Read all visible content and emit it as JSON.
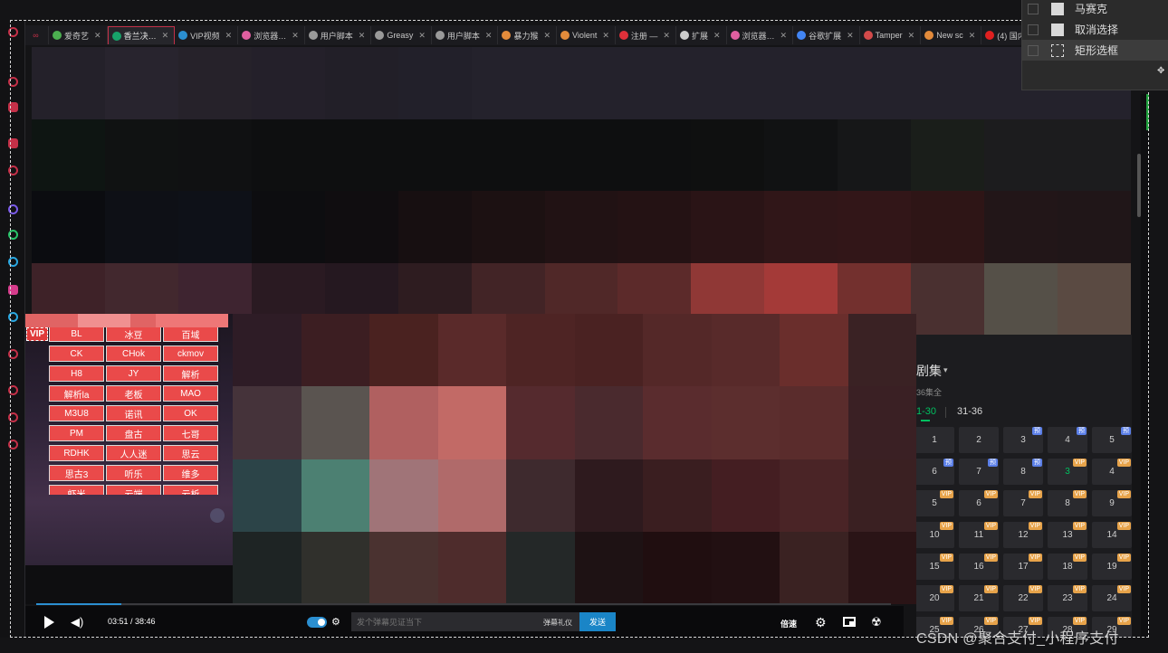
{
  "tabs": [
    {
      "label": "",
      "fav": "#c43048",
      "kind": "mute",
      "name": "tab-mute"
    },
    {
      "label": "爱奇艺",
      "fav": "#4caf50",
      "active": false,
      "name": "tab-iqiyi"
    },
    {
      "label": "香兰决…",
      "fav": "#17a36a",
      "active": true,
      "name": "tab-current"
    },
    {
      "label": "VIP视频",
      "fav": "#2b8fd1",
      "active": false,
      "name": "tab-vip"
    },
    {
      "label": "浏览器…",
      "fav": "#e05fa0",
      "active": false,
      "name": "tab-browser-1"
    },
    {
      "label": "用户脚本",
      "fav": "#9a9a9a",
      "active": false,
      "name": "tab-userscript-1"
    },
    {
      "label": "Greasy",
      "fav": "#9a9a9a",
      "active": false,
      "name": "tab-greasy"
    },
    {
      "label": "用户脚本",
      "fav": "#9a9a9a",
      "active": false,
      "name": "tab-userscript-2"
    },
    {
      "label": "暴力猴",
      "fav": "#e38b3b",
      "active": false,
      "name": "tab-violentmonkey-cn"
    },
    {
      "label": "Violent",
      "fav": "#e38b3b",
      "active": false,
      "name": "tab-violent"
    },
    {
      "label": "注册 —",
      "fav": "#e0303a",
      "active": false,
      "name": "tab-register"
    },
    {
      "label": "扩展",
      "fav": "#cccccc",
      "active": false,
      "name": "tab-extensions"
    },
    {
      "label": "浏览器…",
      "fav": "#e05fa0",
      "active": false,
      "name": "tab-browser-2"
    },
    {
      "label": "谷歌扩展",
      "fav": "#4285f4",
      "active": false,
      "name": "tab-google-ext"
    },
    {
      "label": "Tamper",
      "fav": "#d34a4a",
      "active": false,
      "name": "tab-tamper"
    },
    {
      "label": "New sc",
      "fav": "#e38b3b",
      "active": false,
      "name": "tab-new-script"
    },
    {
      "label": "(4) 国内…",
      "fav": "#e02020",
      "active": false,
      "name": "tab-youtube"
    }
  ],
  "context_menu": {
    "items": [
      {
        "label": "马赛克",
        "icon": "doc-icon"
      },
      {
        "label": "取消选择",
        "icon": "doc-icon"
      },
      {
        "label": "矩形选框",
        "icon": "rect-select-icon",
        "hover": true
      }
    ]
  },
  "vip": {
    "label": "VIP",
    "buttons": [
      "BL",
      "冰豆",
      "百域",
      "CK",
      "CHok",
      "ckmov",
      "H8",
      "JY",
      "解析",
      "解析la",
      "老板",
      "MAO",
      "M3U8",
      "诺讯",
      "OK",
      "PM",
      "盘古",
      "七哥",
      "RDHK",
      "人人迷",
      "思云",
      "思古3",
      "听乐",
      "维多",
      "虾米",
      "云端",
      "云析"
    ]
  },
  "episodes": {
    "title": "剧集",
    "subtitle": "36集全",
    "ranges": [
      "1-30",
      "31-36"
    ],
    "active_range": "1-30",
    "current": "3",
    "rows": [
      [
        {
          "n": "1",
          "b": ""
        },
        {
          "n": "2",
          "b": ""
        },
        {
          "n": "3",
          "b": "预"
        },
        {
          "n": "4",
          "b": "预"
        },
        {
          "n": "5",
          "b": "预"
        }
      ],
      [
        {
          "n": "6",
          "b": "预"
        },
        {
          "n": "7",
          "b": "预"
        },
        {
          "n": "8",
          "b": "预"
        },
        {
          "n": "3",
          "b": "VIP",
          "cur": true
        },
        {
          "n": "4",
          "b": "VIP"
        }
      ],
      [
        {
          "n": "5",
          "b": "VIP"
        },
        {
          "n": "6",
          "b": "VIP"
        },
        {
          "n": "7",
          "b": "VIP"
        },
        {
          "n": "8",
          "b": "VIP"
        },
        {
          "n": "9",
          "b": "VIP"
        }
      ],
      [
        {
          "n": "10",
          "b": "VIP"
        },
        {
          "n": "11",
          "b": "VIP"
        },
        {
          "n": "12",
          "b": "VIP"
        },
        {
          "n": "13",
          "b": "VIP"
        },
        {
          "n": "14",
          "b": "VIP"
        }
      ],
      [
        {
          "n": "15",
          "b": "VIP"
        },
        {
          "n": "16",
          "b": "VIP"
        },
        {
          "n": "17",
          "b": "VIP"
        },
        {
          "n": "18",
          "b": "VIP"
        },
        {
          "n": "19",
          "b": "VIP"
        }
      ],
      [
        {
          "n": "20",
          "b": "VIP"
        },
        {
          "n": "21",
          "b": "VIP"
        },
        {
          "n": "22",
          "b": "VIP"
        },
        {
          "n": "23",
          "b": "VIP"
        },
        {
          "n": "24",
          "b": "VIP"
        }
      ],
      [
        {
          "n": "25",
          "b": "VIP"
        },
        {
          "n": "26",
          "b": "VIP"
        },
        {
          "n": "27",
          "b": "VIP"
        },
        {
          "n": "28",
          "b": "VIP"
        },
        {
          "n": "29",
          "b": "VIP"
        }
      ]
    ]
  },
  "player": {
    "time": "03:51 / 38:46",
    "progress": 0.0993,
    "danmaku_placeholder": "发个弹幕见证当下",
    "danmaku_gift": "弹幕礼仪",
    "send_label": "发送",
    "speed_label": "倍速"
  },
  "watermark": "CSDN @聚合支付_小程序支付",
  "colors": {
    "accent_red": "#ea4a4a",
    "accent_blue": "#1a85c7",
    "accent_green": "#00c060",
    "vip_badge": "#e7a34a"
  },
  "mosaic_colors": [
    [
      "#24212a",
      "#28242e",
      "#26222a",
      "#24202a",
      "#221f28",
      "#22202a",
      "#24222c",
      "#24222c",
      "#24222c",
      "#24222c",
      "#24222c",
      "#24222c",
      "#24222c",
      "#24222c",
      "#24222c"
    ],
    [
      "#0e1512",
      "#101212",
      "#101112",
      "#0e0f10",
      "#0e0f10",
      "#0e0f10",
      "#0e0f10",
      "#0e0f10",
      "#0e0f10",
      "#0f1010",
      "#111213",
      "#161718",
      "#1a1e1a",
      "#1c1c1e",
      "#1c1c1e"
    ],
    [
      "#0b0c10",
      "#0e1016",
      "#0e1118",
      "#0d0d10",
      "#100d10",
      "#170f11",
      "#1c1112",
      "#211214",
      "#241214",
      "#2a1416",
      "#301618",
      "#321618",
      "#2e1516",
      "#221618",
      "#201618"
    ],
    [
      "#3e2228",
      "#42282e",
      "#3e2430",
      "#2a1a22",
      "#251820",
      "#2e1c20",
      "#422426",
      "#502828",
      "#5c2a2a",
      "#903836",
      "#a43a38",
      "#73302e",
      "#4a3030",
      "#555048",
      "#5a4a42"
    ]
  ],
  "mosaic_lower_colors": [
    [
      "#2e1c26",
      "#3c1e22",
      "#4a2220",
      "#5a2a2a",
      "#4e2424",
      "#4a2222",
      "#542828",
      "#582a2a",
      "#6a2e2c",
      "#3a2224"
    ],
    [
      "#45333a",
      "#5a5450",
      "#b06060",
      "#c26a66",
      "#552a2e",
      "#4a2a2e",
      "#5a2c2e",
      "#5c2e2e",
      "#5a2c2c",
      "#3a2024"
    ],
    [
      "#2c4448",
      "#4c8072",
      "#a07478",
      "#b06a6a",
      "#3e2a2e",
      "#2e1a1e",
      "#3a1e20",
      "#441e22",
      "#4a2426",
      "#3a2022"
    ],
    [
      "#1e2424",
      "#30302c",
      "#4a3230",
      "#4e2c2c",
      "#242828",
      "#1e1214",
      "#200e10",
      "#221012",
      "#3a2222",
      "#2a1416"
    ]
  ]
}
